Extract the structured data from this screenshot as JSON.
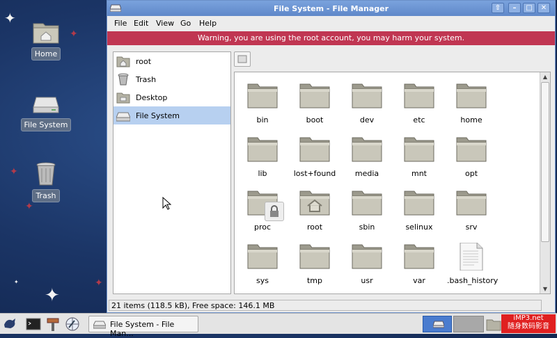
{
  "desktop": {
    "icons": [
      {
        "label": "Home"
      },
      {
        "label": "File System"
      },
      {
        "label": "Trash"
      }
    ]
  },
  "window": {
    "title": "File System - File Manager",
    "menu": [
      "File",
      "Edit",
      "View",
      "Go",
      "Help"
    ],
    "warning": "Warning, you are using the root account, you may harm your system.",
    "sidebar": [
      {
        "label": "root",
        "icon": "home-folder-icon"
      },
      {
        "label": "Trash",
        "icon": "trash-icon"
      },
      {
        "label": "Desktop",
        "icon": "desktop-folder-icon"
      },
      {
        "label": "File System",
        "icon": "drive-icon",
        "selected": true
      }
    ],
    "files": [
      "bin",
      "boot",
      "dev",
      "etc",
      "home",
      "lib",
      "lost+found",
      "media",
      "mnt",
      "opt",
      "proc",
      "root",
      "sbin",
      "selinux",
      "srv",
      "sys",
      "tmp",
      "usr",
      "var",
      ".bash_history"
    ],
    "status": "21 items (118.5 kB), Free space: 146.1 MB"
  },
  "taskbar": {
    "task_label": "File System - File Man...",
    "watermark_line1": "iMP3.net",
    "watermark_line2": "随身数码影音"
  },
  "colors": {
    "warning_bg": "#c03652",
    "selection": "#b7d0f0",
    "titlebar": "#6f97d6"
  }
}
